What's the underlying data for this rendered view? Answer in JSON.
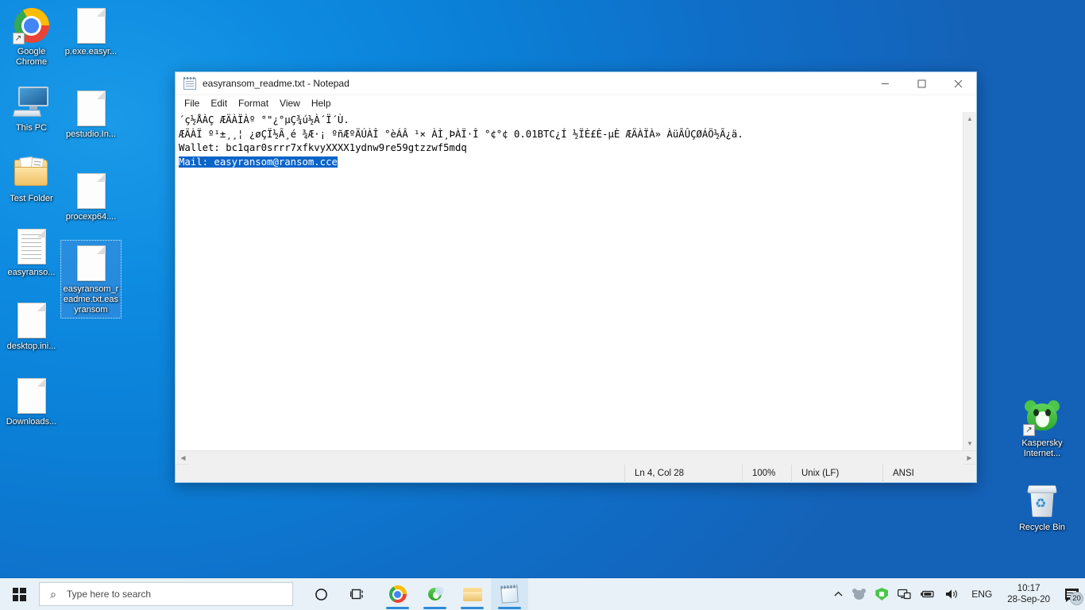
{
  "desktop": {
    "icons_left_col1": [
      {
        "label": "Google Chrome",
        "icon": "chrome-icon",
        "shortcut": true
      },
      {
        "label": "This PC",
        "icon": "computer-icon",
        "shortcut": false
      },
      {
        "label": "Test Folder",
        "icon": "folder-pdf-icon",
        "shortcut": false
      },
      {
        "label": "easyranso...",
        "icon": "lined-document-icon",
        "shortcut": false
      },
      {
        "label": "desktop.ini...",
        "icon": "blank-document-icon",
        "shortcut": false
      },
      {
        "label": "Downloads...",
        "icon": "blank-document-icon",
        "shortcut": false
      }
    ],
    "icons_left_col2": [
      {
        "label": "p.exe.easyr...",
        "icon": "blank-document-icon",
        "selected": false
      },
      {
        "label": "pestudio.In...",
        "icon": "blank-document-icon",
        "selected": false
      },
      {
        "label": "procexp64....",
        "icon": "blank-document-icon",
        "selected": false
      },
      {
        "label": "easyransom_readme.txt.easyransom",
        "icon": "blank-document-icon",
        "selected": true
      }
    ],
    "icons_right": [
      {
        "label": "Kaspersky Internet...",
        "icon": "kaspersky-icon",
        "shortcut": true
      },
      {
        "label": "Recycle Bin",
        "icon": "recycle-bin-icon",
        "shortcut": false
      }
    ]
  },
  "notepad": {
    "title": "easyransom_readme.txt - Notepad",
    "title_icon": "notepad-icon",
    "menu": [
      "File",
      "Edit",
      "Format",
      "View",
      "Help"
    ],
    "window_controls": {
      "minimize": "minimize-button",
      "maximize": "maximize-button",
      "close": "close-button"
    },
    "content": {
      "line1": "´ç½ÅÀÇ ÆÄÀÏÀº °\"¿°µÇ¾ú½À´Ï´Ù.",
      "line2": "ÆÄÀÏ º¹±¸¸¦ ¿øÇÏ½Ã¸é ¾Æ·¡ ºñÆºÄÚÀÎ °èÁÂ ¹× ÀÌ¸ÞÀÏ·Î °¢°¢ 0.01BTC¿Í ½ÏÈ£È-µÈ ÆÄÀÏÀ» ÀüÃÛÇØÁÖ½Ã¿ä.",
      "line3": "Wallet: bc1qar0srrr7xfkvyXXXX1ydnw9re59gtzzwf5mdq",
      "line4_selected": "Mail: easyransom@ransom.cce"
    },
    "status": {
      "position": "Ln 4, Col 28",
      "zoom": "100%",
      "eol": "Unix (LF)",
      "encoding": "ANSI"
    },
    "scrollbar": {
      "up_arrow": "scroll-up-icon",
      "down_arrow": "scroll-down-icon",
      "left_arrow": "scroll-left-icon",
      "right_arrow": "scroll-right-icon"
    }
  },
  "taskbar": {
    "start_label": "start-button",
    "search_placeholder": "Type here to search",
    "search_value": "",
    "cortana_label": "cortana-button",
    "taskview_label": "task-view-button",
    "apps": [
      {
        "name": "chrome",
        "running": true
      },
      {
        "name": "kaspersky",
        "running": true
      },
      {
        "name": "file-explorer",
        "running": true
      },
      {
        "name": "notepad",
        "running": true,
        "active": true
      }
    ],
    "tray": {
      "chevron": "show-hidden-icons-icon",
      "bear": "kaspersky-tray-icon",
      "shield": "kaspersky-shield-tray-icon",
      "network": "network-icon",
      "battery": "battery-icon",
      "volume": "volume-icon",
      "language": "ENG",
      "time": "10:17",
      "date": "28-Sep-20",
      "notification_count": "20"
    }
  },
  "colors": {
    "accent": "#0b64c8",
    "taskbar_bg": "#e8f1f8",
    "desktop_blue": "#0d8ae0",
    "selection": "#0b64c8"
  }
}
